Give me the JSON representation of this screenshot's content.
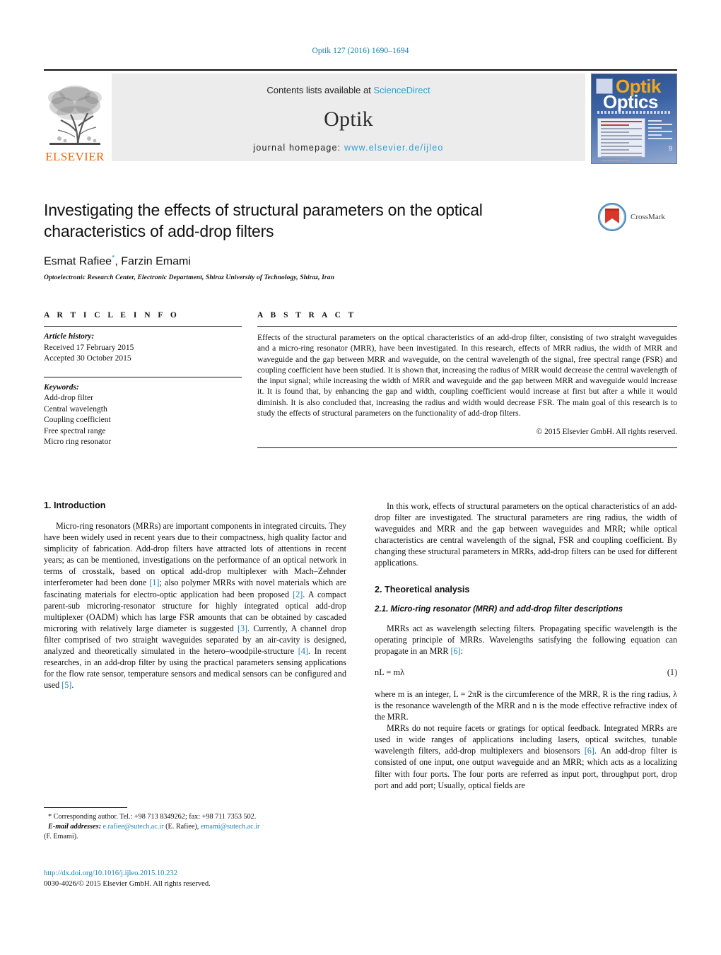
{
  "running_head": "Optik 127 (2016) 1690–1694",
  "masthead": {
    "publisher": "ELSEVIER",
    "contents_prefix": "Contents lists available at ",
    "contents_link": "ScienceDirect",
    "journal_name": "Optik",
    "homepage_prefix": "journal homepage: ",
    "homepage_url": "www.elsevier.de/ijleo",
    "cover": {
      "title_top": "Optik",
      "title_bottom": "Optics",
      "issue_number": "9"
    }
  },
  "article": {
    "title": "Investigating the effects of structural parameters on the optical characteristics of add-drop filters",
    "authors_part1": "Esmat Rafiee",
    "author_marker": "*",
    "authors_part2": ", Farzin Emami",
    "affiliation": "Optoelectronic Research Center, Electronic Department, Shiraz University of Technology, Shiraz, Iran",
    "crossmark_label": "CrossMark"
  },
  "article_info": {
    "heading": "A R T I C L E   I N F O",
    "history_label": "Article history:",
    "received": "Received 17 February 2015",
    "accepted": "Accepted 30 October 2015",
    "keywords_label": "Keywords:",
    "keywords": [
      "Add-drop filter",
      "Central wavelength",
      "Coupling coefficient",
      "Free spectral range",
      "Micro ring resonator"
    ]
  },
  "abstract": {
    "heading": "A B S T R A C T",
    "text": "Effects of the structural parameters on the optical characteristics of an add-drop filter, consisting of two straight waveguides and a micro-ring resonator (MRR), have been investigated. In this research, effects of MRR radius, the width of MRR and waveguide and the gap between MRR and waveguide, on the central wavelength of the signal, free spectral range (FSR) and coupling coefficient have been studied. It is shown that, increasing the radius of MRR would decrease the central wavelength of the input signal; while increasing the width of MRR and waveguide and the gap between MRR and waveguide would increase it. It is found that, by enhancing the gap and width, coupling coefficient would increase at first but after a while it would diminish. It is also concluded that, increasing the radius and width would decrease FSR. The main goal of this research is to study the effects of structural parameters on the functionality of add-drop filters.",
    "copyright": "© 2015 Elsevier GmbH. All rights reserved."
  },
  "body": {
    "left": {
      "section1_heading": "1.  Introduction",
      "para1_a": "Micro-ring resonators (MRRs) are important components in integrated circuits. They have been widely used in recent years due to their compactness, high quality factor and simplicity of fabrication. Add-drop filters have attracted lots of attentions in recent years; as can be mentioned, investigations on the performance of an optical network in terms of crosstalk, based on optical add-drop multiplexer with Mach–Zehnder interferometer had been done ",
      "ref1": "[1]",
      "para1_b": "; also polymer MRRs with novel materials which are fascinating materials for electro-optic application had been proposed ",
      "ref2": "[2]",
      "para1_c": ". A compact parent-sub microring-resonator structure for highly integrated optical add-drop multiplexer (OADM) which has large FSR amounts that can be obtained by cascaded microring with relatively large diameter is suggested ",
      "ref3": "[3]",
      "para1_d": ". Currently, A channel drop filter comprised of two straight waveguides separated by an air-cavity is designed, analyzed and theoretically simulated in the hetero–woodpile-structure ",
      "ref4": "[4]",
      "para1_e": ". In recent researches, in an add-drop filter by using the practical parameters sensing applications for the flow rate sensor, temperature sensors and medical sensors can be configured and used ",
      "ref5": "[5]",
      "para1_f": "."
    },
    "right": {
      "para_intro": "In this work, effects of structural parameters on the optical characteristics of an add-drop filter are investigated. The structural parameters are ring radius, the width of waveguides and MRR and the gap between waveguides and MRR; while optical characteristics are central wavelength of the signal, FSR and coupling coefficient. By changing these structural parameters in MRRs, add-drop filters can be used for different applications.",
      "section2_heading": "2.  Theoretical analysis",
      "subsection_heading": "2.1.  Micro-ring resonator (MRR) and add-drop filter descriptions",
      "para_mrr_a": "MRRs act as wavelength selecting filters. Propagating specific wavelength is the operating principle of MRRs. Wavelengths satisfying the following equation can propagate in an MRR ",
      "ref6": "[6]",
      "para_mrr_b": ":",
      "equation": "nL = mλ",
      "equation_number": "(1)",
      "para_where": "where m is an integer, L = 2πR is the circumference of the MRR, R is the ring radius, λ is the resonance wavelength of the MRR and n is the mode effective refractive index of the MRR.",
      "para_last_a": "MRRs do not require facets or gratings for optical feedback. Integrated MRRs are used in wide ranges of applications including lasers, optical switches, tunable wavelength filters, add-drop multiplexers and biosensors ",
      "ref6b": "[6]",
      "para_last_b": ". An add-drop filter is consisted of one input, one output waveguide and an MRR; which acts as a localizing filter with four ports. The four ports are referred as input port, throughput port, drop port and add port; Usually, optical fields are"
    }
  },
  "footnote": {
    "marker": "*",
    "corresponding": " Corresponding author. Tel.: +98 713 8349262; fax: +98 711 7353 502.",
    "email_label": "E-mail addresses:",
    "email1": "e.rafiee@sutech.ac.ir",
    "email1_owner": " (E. Rafiee), ",
    "email2": "emami@sutech.ac.ir",
    "email2_owner": "(F. Emami)."
  },
  "doi": {
    "url": "http://dx.doi.org/10.1016/j.ijleo.2015.10.232",
    "issn": "0030-4026/© 2015 Elsevier GmbH. All rights reserved."
  },
  "colors": {
    "link": "#1b82b5",
    "accent": "#2e9fd4",
    "elsevier_orange": "#eb6608"
  }
}
